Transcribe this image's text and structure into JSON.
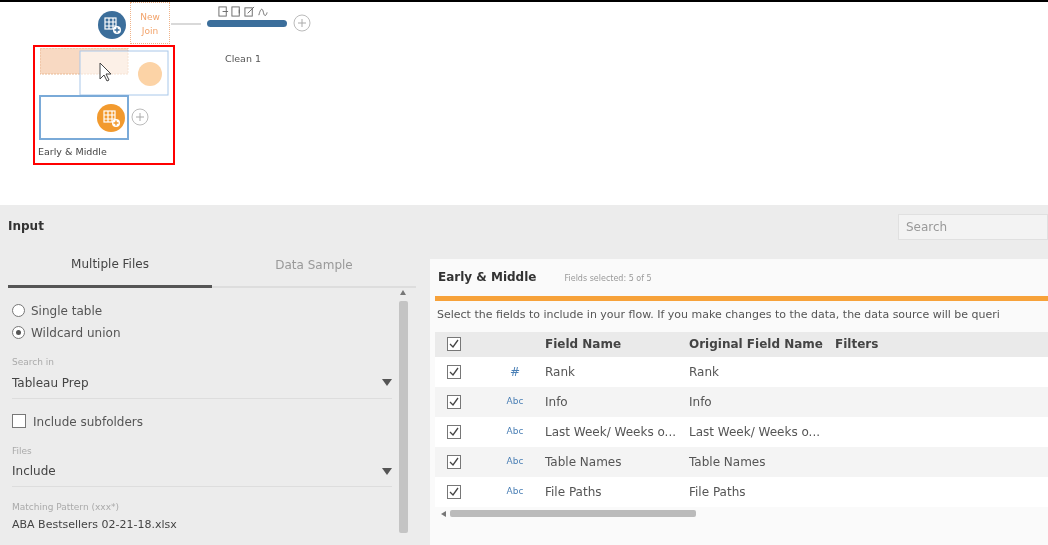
{
  "flow": {
    "join_node": {
      "label": "New Join"
    },
    "clean_step": {
      "label": "Clean 1"
    },
    "input_node": {
      "label": "Early & Middle",
      "selected": true
    },
    "highlight": {
      "on": true
    }
  },
  "input_panel": {
    "title": "Input",
    "tabs": [
      {
        "label": "Multiple Files",
        "selected": true
      },
      {
        "label": "Data Sample",
        "selected": false
      }
    ],
    "options": [
      {
        "label": "Single table",
        "selected": false
      },
      {
        "label": "Wildcard union",
        "selected": true
      }
    ],
    "search_in": {
      "label": "Search in",
      "value": "Tableau Prep"
    },
    "include_subfolders": {
      "label": "Include subfolders",
      "checked": false
    },
    "files": {
      "label": "Files",
      "value": "Include"
    },
    "matching_pattern": {
      "label": "Matching Pattern (xxx*)",
      "value": "ABA Bestsellers 02-21-18.xlsx"
    }
  },
  "search": {
    "placeholder": "Search"
  },
  "fields_panel": {
    "title": "Early & Middle",
    "count": "Fields selected: 5 of 5",
    "instruction": "Select the fields to include in your flow. If you make changes to the data, the data source will be queri",
    "columns": [
      "Field Name",
      "Original Field Name",
      "Filters"
    ],
    "all_checked": true,
    "rows": [
      {
        "checked": true,
        "kind": "number",
        "type_label": "#",
        "field": "Rank",
        "original": "Rank"
      },
      {
        "checked": true,
        "kind": "string",
        "type_label": "Abc",
        "field": "Info",
        "original": "Info"
      },
      {
        "checked": true,
        "kind": "string",
        "type_label": "Abc",
        "field": "Last Week/ Weeks o...",
        "original": "Last Week/ Weeks o..."
      },
      {
        "checked": true,
        "kind": "string",
        "type_label": "Abc",
        "field": "Table Names",
        "original": "Table Names"
      },
      {
        "checked": true,
        "kind": "string",
        "type_label": "Abc",
        "field": "File Paths",
        "original": "File Paths"
      }
    ]
  }
}
